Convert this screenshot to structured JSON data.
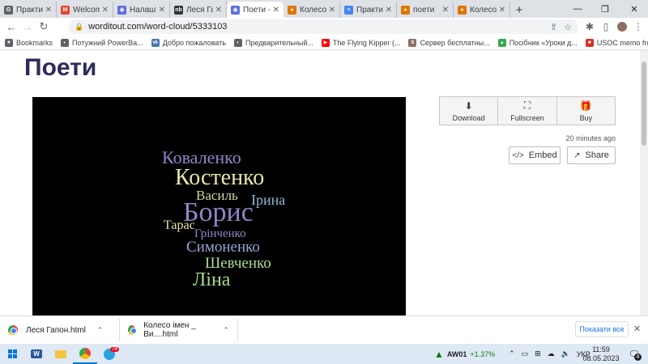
{
  "browser": {
    "tabs": [
      {
        "title": "Практич",
        "fav_color": "#5f6368",
        "fav_glyph": "G"
      },
      {
        "title": "Welcome",
        "fav_color": "#ea4335",
        "fav_glyph": "M"
      },
      {
        "title": "Налашту",
        "fav_color": "#5b6ee1",
        "fav_glyph": "◉"
      },
      {
        "title": "Леся Гап",
        "fav_color": "#333",
        "fav_glyph": "nb"
      },
      {
        "title": "Поети -",
        "fav_color": "#5b6ee1",
        "fav_glyph": "◉",
        "active": true
      },
      {
        "title": "Колесо",
        "fav_color": "#e37400",
        "fav_glyph": "●"
      },
      {
        "title": "Практич",
        "fav_color": "#4285f4",
        "fav_glyph": "≡"
      },
      {
        "title": "поети",
        "fav_color": "#e37400",
        "fav_glyph": "●"
      },
      {
        "title": "Колесо",
        "fav_color": "#e37400",
        "fav_glyph": "●"
      }
    ],
    "url": "worditout.com/word-cloud/5333103",
    "bookmarks": [
      {
        "label": "Bookmarks",
        "icon": "star-icon",
        "color": "#5f6368",
        "glyph": "★"
      },
      {
        "label": "Потужний PowerBa...",
        "icon": "globe-icon",
        "color": "#5f6368",
        "glyph": "◐"
      },
      {
        "label": "Добро пожаловать",
        "icon": "vk-icon",
        "color": "#4a76a8",
        "glyph": "vk"
      },
      {
        "label": "Предварительный...",
        "icon": "globe-icon",
        "color": "#5f6368",
        "glyph": "◐"
      },
      {
        "label": "The Flying Kipper (...",
        "icon": "youtube-icon",
        "color": "#ff0000",
        "glyph": "▶"
      },
      {
        "label": "Сервер бесплатны...",
        "icon": "site-icon",
        "color": "#8d6e63",
        "glyph": "S"
      },
      {
        "label": "Посібник «Уроки д...",
        "icon": "drive-icon",
        "color": "#34a853",
        "glyph": "▲"
      },
      {
        "label": "USOC memo from...",
        "icon": "doc-icon",
        "color": "#d93025",
        "glyph": "■"
      }
    ]
  },
  "page": {
    "title": "Поети",
    "cloud_words": [
      {
        "text": "Коваленко",
        "color": "#8f86c8",
        "size": 22
      },
      {
        "text": "Костенко",
        "color": "#e8e6a8",
        "size": 28
      },
      {
        "text": "Василь",
        "color": "#d2d49a",
        "size": 17
      },
      {
        "text": "Ірина",
        "color": "#8eb6d8",
        "size": 18
      },
      {
        "text": "Борис",
        "color": "#8f86c8",
        "size": 34
      },
      {
        "text": "Тарас",
        "color": "#e8e6a8",
        "size": 16
      },
      {
        "text": "Грінченко",
        "color": "#8f86c8",
        "size": 15
      },
      {
        "text": "Симоненко",
        "color": "#9aa3d8",
        "size": 19
      },
      {
        "text": "Шевченко",
        "color": "#a6dc8e",
        "size": 19
      },
      {
        "text": "Ліна",
        "color": "#a6dc8e",
        "size": 24
      }
    ],
    "actions": [
      {
        "label": "Download",
        "icon": "download-icon",
        "glyph": "⬇"
      },
      {
        "label": "Fullscreen",
        "icon": "fullscreen-icon",
        "glyph": "⛶"
      },
      {
        "label": "Buy",
        "icon": "gift-icon",
        "glyph": "🎁"
      }
    ],
    "time_ago": "20 minutes ago",
    "embed_label": "Embed",
    "share_label": "Share"
  },
  "downloads": {
    "items": [
      {
        "name": "Леся Гапон.html"
      },
      {
        "name": "Колесо імен _ Ви....html"
      }
    ],
    "show_all": "Показати все"
  },
  "taskbar": {
    "stock_name": "AW01",
    "stock_change": "+1.37%",
    "lang": "УКР",
    "time": "11:59",
    "date": "08.05.2023",
    "notif_count": "4",
    "badge_count": "74"
  }
}
